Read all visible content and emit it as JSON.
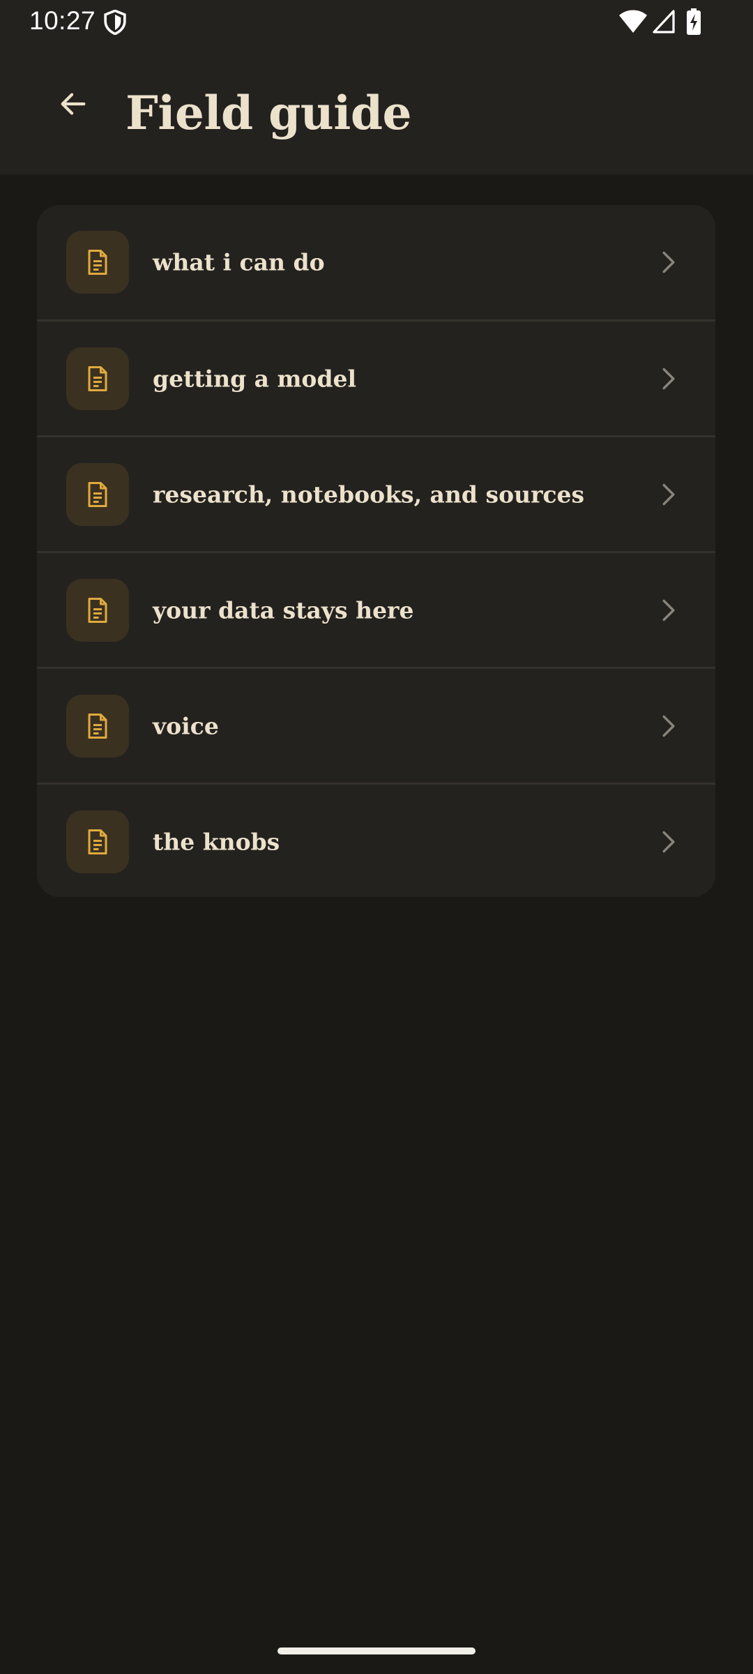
{
  "status_bar": {
    "time": "10:27",
    "icons": [
      "shield-icon",
      "wifi-icon",
      "cellular-signal-icon",
      "battery-charging-icon"
    ]
  },
  "app_bar": {
    "back_icon": "arrow-back-icon",
    "title": "Field guide"
  },
  "colors": {
    "background": "#1a1916",
    "surface": "#24221f",
    "title_text": "#ece2cc",
    "accent_icon": "#e0aa3e",
    "icon_tile": "#3a3121",
    "chevron": "#8a857c"
  },
  "guide_items": [
    {
      "label": "what i can do",
      "icon": "document-icon"
    },
    {
      "label": "getting a model",
      "icon": "document-icon"
    },
    {
      "label": "research, notebooks, and sources",
      "icon": "document-icon"
    },
    {
      "label": "your data stays here",
      "icon": "document-icon"
    },
    {
      "label": "voice",
      "icon": "document-icon"
    },
    {
      "label": "the knobs",
      "icon": "document-icon"
    }
  ]
}
